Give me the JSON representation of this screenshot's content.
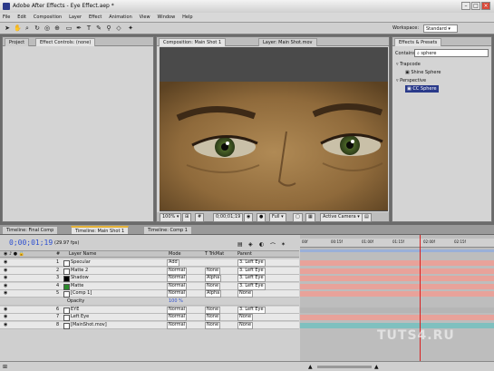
{
  "window": {
    "title": "Adobe After Effects - Eye Effect.aep *"
  },
  "menu": [
    "File",
    "Edit",
    "Composition",
    "Layer",
    "Effect",
    "Animation",
    "View",
    "Window",
    "Help"
  ],
  "toolbar": {
    "workspace_label": "Workspace:",
    "workspace_value": "Standard"
  },
  "left_panel": {
    "tabs": [
      "Project",
      "Effect Controls: (none)"
    ]
  },
  "comp_panel": {
    "tabs": [
      "Composition: Main Shot 1",
      "Layer: Main Shot.mov"
    ],
    "zoom": "100%",
    "timecode": "0;00;01;19",
    "resolution": "Full",
    "view": "Active Camera"
  },
  "effects_panel": {
    "tab": "Effects & Presets",
    "contains_label": "Contains:",
    "contains_value": "sphere",
    "tree": [
      {
        "label": "Trapcode",
        "depth": 0
      },
      {
        "label": "Shine Sphere",
        "depth": 1
      },
      {
        "label": "Perspective",
        "depth": 0
      },
      {
        "label": "CC Sphere",
        "depth": 1,
        "selected": true
      }
    ]
  },
  "timeline": {
    "tabs": [
      "Timeline: Final Comp",
      "Timeline: Main Shot 1",
      "Timeline: Comp 1"
    ],
    "timecode": "0;00;01;19",
    "fps": "(29.97 fps)",
    "headers": {
      "num": "#",
      "name": "Layer Name",
      "mode": "Mode",
      "trkmat": "T  TrkMat",
      "parent": "Parent"
    },
    "layers": [
      {
        "num": "1",
        "name": "Specular",
        "mode": "Add",
        "trkmat": "",
        "parent": "3. Left Eye",
        "color": "#ffffff",
        "bar": "#e8a29a"
      },
      {
        "num": "2",
        "name": "Matte 2",
        "mode": "Normal",
        "trkmat": "None",
        "parent": "3. Left Eye",
        "color": "#ffffff",
        "bar": "#e8a29a"
      },
      {
        "num": "3",
        "name": "Shadow",
        "mode": "Normal",
        "trkmat": "Alpha",
        "parent": "3. Left Eye",
        "color": "#000000",
        "bar": "#e8a29a"
      },
      {
        "num": "4",
        "name": "Matte",
        "mode": "Normal",
        "trkmat": "None",
        "parent": "3. Left Eye",
        "color": "#2a8a2a",
        "bar": "#e8a29a"
      },
      {
        "num": "5",
        "name": "[Comp 1]",
        "mode": "Normal",
        "trkmat": "Alpha",
        "parent": "None",
        "color": "#ffffff",
        "bar": "#e8a29a"
      },
      {
        "num": "",
        "name": "Opacity",
        "mode": "100 %",
        "trkmat": "",
        "parent": "",
        "color": "",
        "bar": "#bdbdbd",
        "sub": true
      },
      {
        "num": "6",
        "name": "EYE",
        "mode": "Normal",
        "trkmat": "None",
        "parent": "3. Left Eye",
        "color": "#ffffff",
        "bar": "#b5b5b5"
      },
      {
        "num": "7",
        "name": "Left Eye",
        "mode": "Normal",
        "trkmat": "None",
        "parent": "None",
        "color": "#ffffff",
        "bar": "#e8a29a"
      },
      {
        "num": "8",
        "name": "[MainShot.mov]",
        "mode": "Normal",
        "trkmat": "None",
        "parent": "None",
        "color": "#ffffff",
        "bar": "#7fc0bf"
      }
    ],
    "ruler_ticks": [
      "00f",
      "00:15f",
      "01:00f",
      "01:15f",
      "02:00f",
      "02:15f"
    ]
  },
  "watermark": "TUTS4.RU"
}
